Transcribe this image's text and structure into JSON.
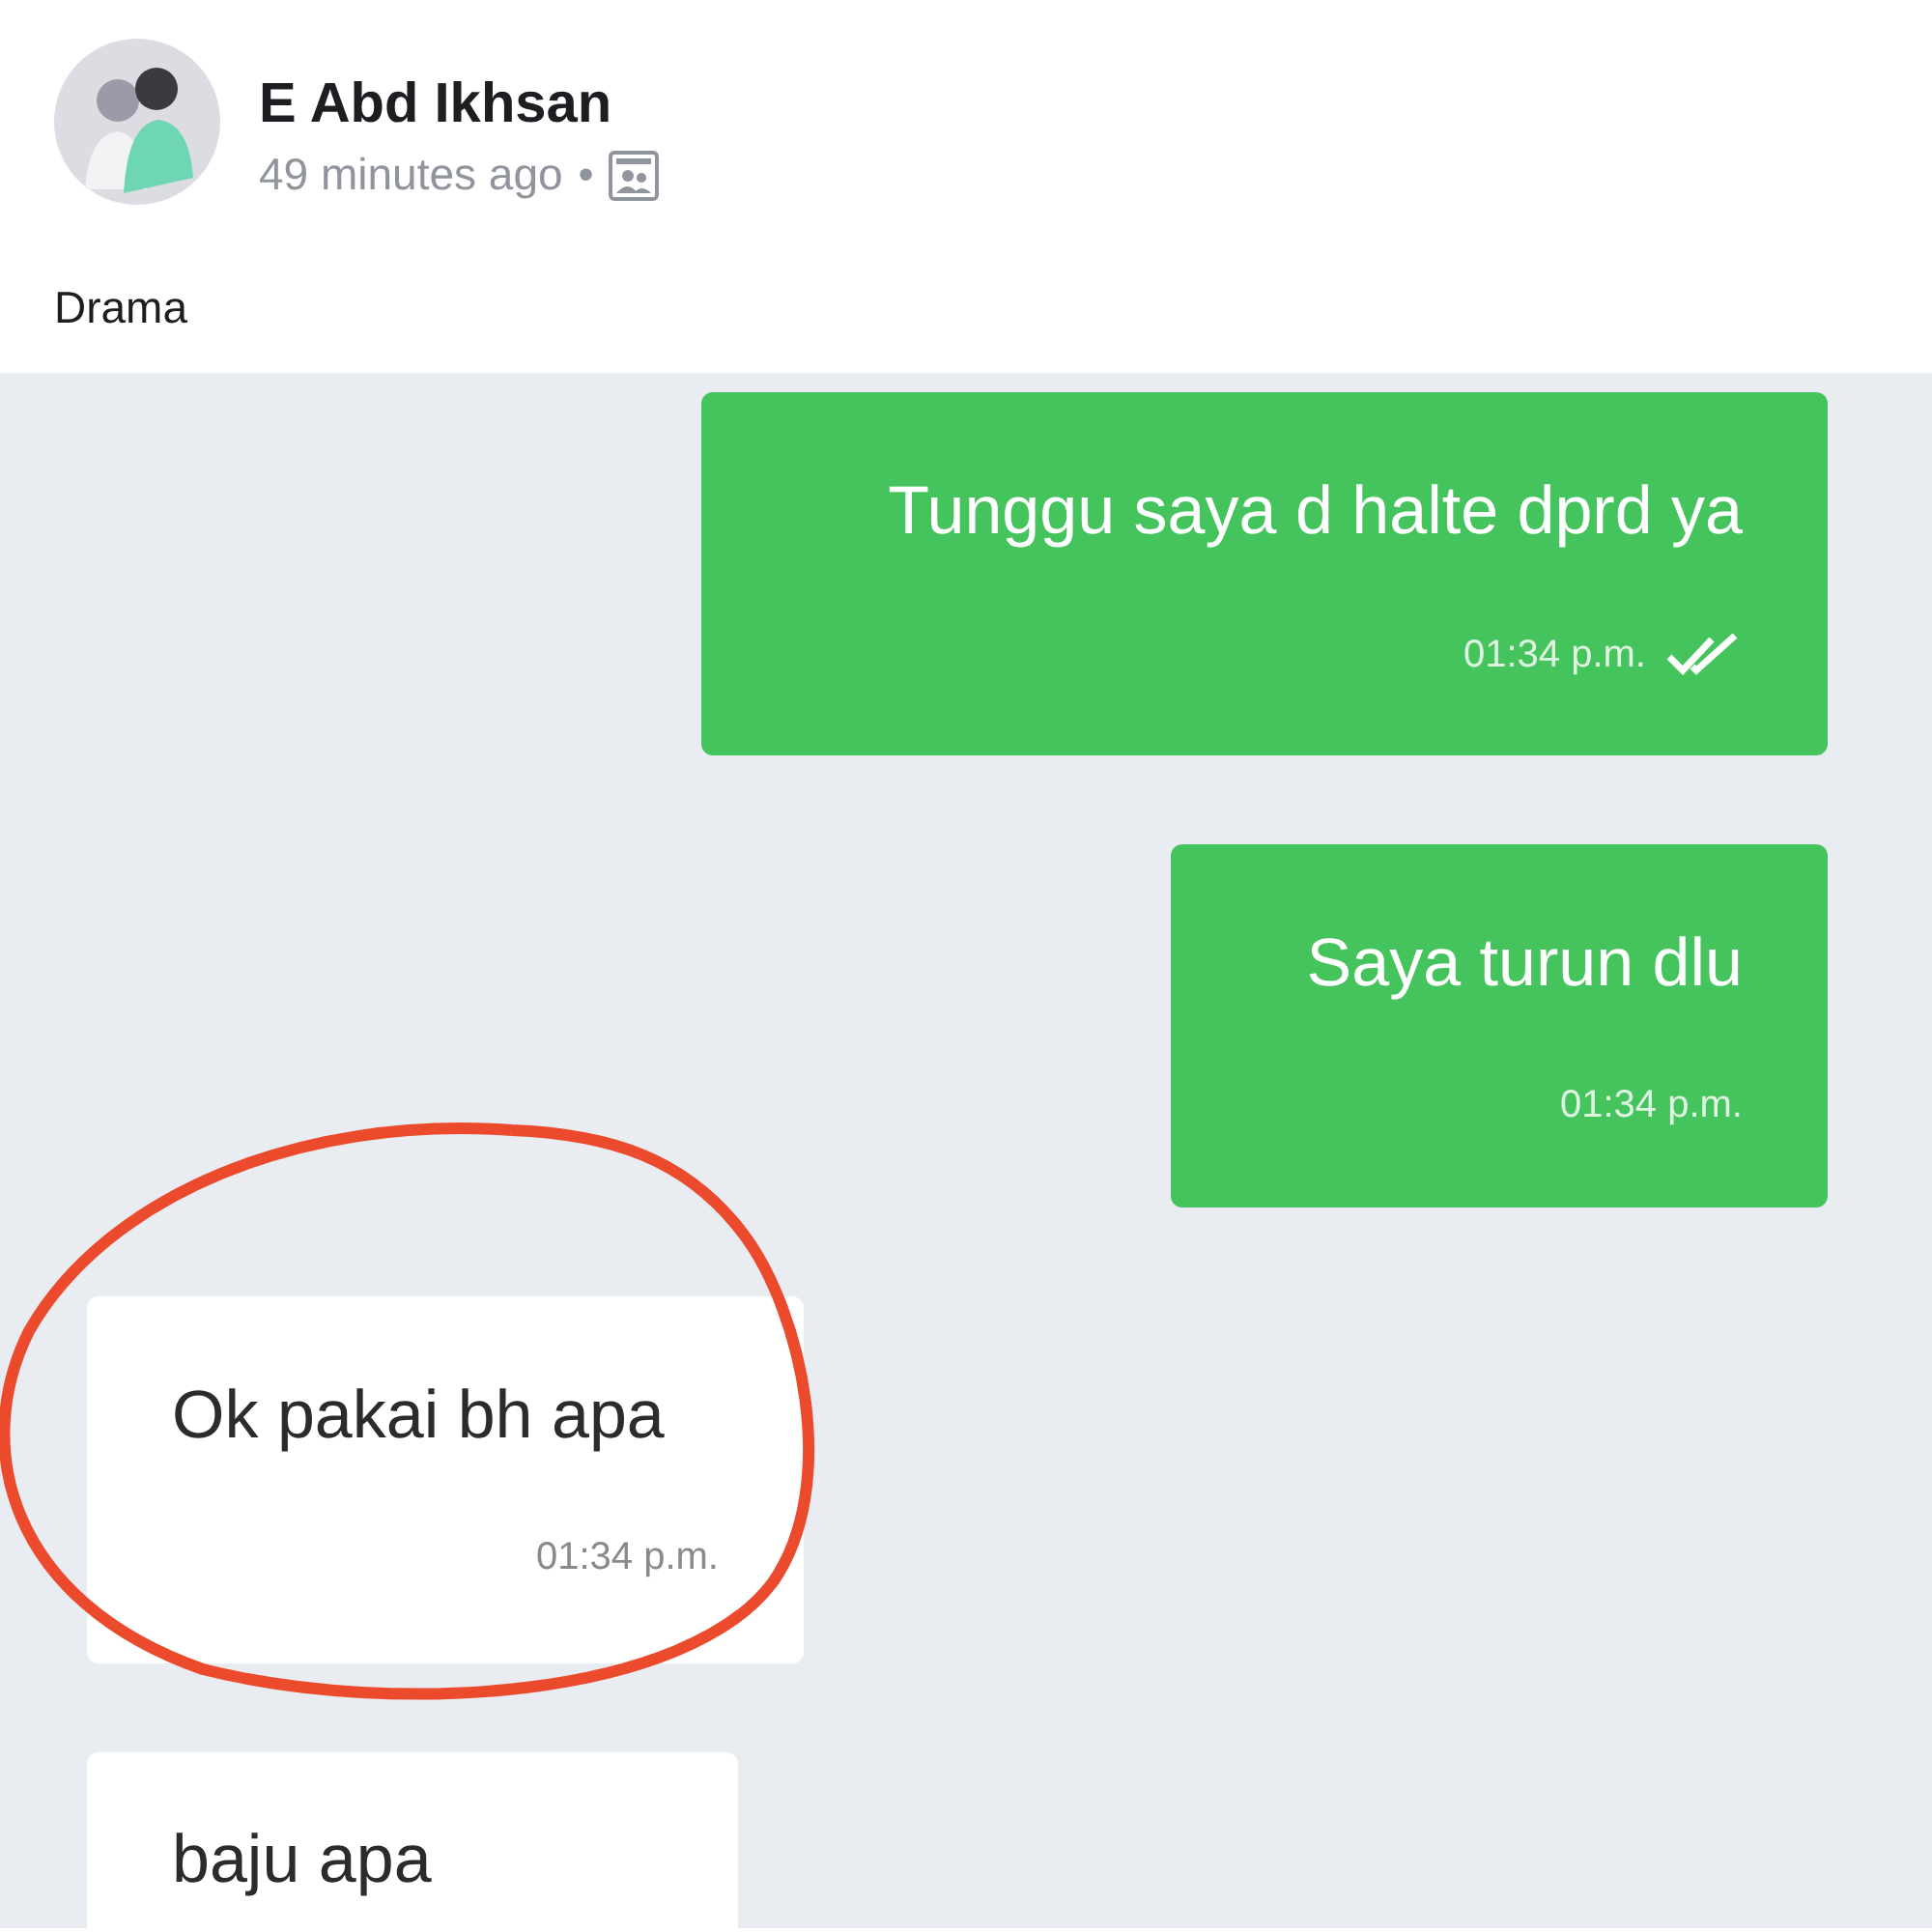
{
  "post": {
    "author": "E Abd Ikhsan",
    "time": "49 minutes ago",
    "separator": "•",
    "text": "Drama"
  },
  "chat": {
    "messages": [
      {
        "kind": "sent",
        "text": "Tunggu saya d halte dprd ya",
        "time": "01:34 p.m.",
        "read": true,
        "circled": false
      },
      {
        "kind": "sent",
        "text": "Saya turun dlu",
        "time": "01:34 p.m.",
        "read": false,
        "circled": false
      },
      {
        "kind": "received",
        "text": "Ok pakai bh apa",
        "time": "01:34 p.m.",
        "read": false,
        "circled": true
      },
      {
        "kind": "received",
        "text": "baju apa",
        "read": false,
        "circled": false
      }
    ]
  }
}
